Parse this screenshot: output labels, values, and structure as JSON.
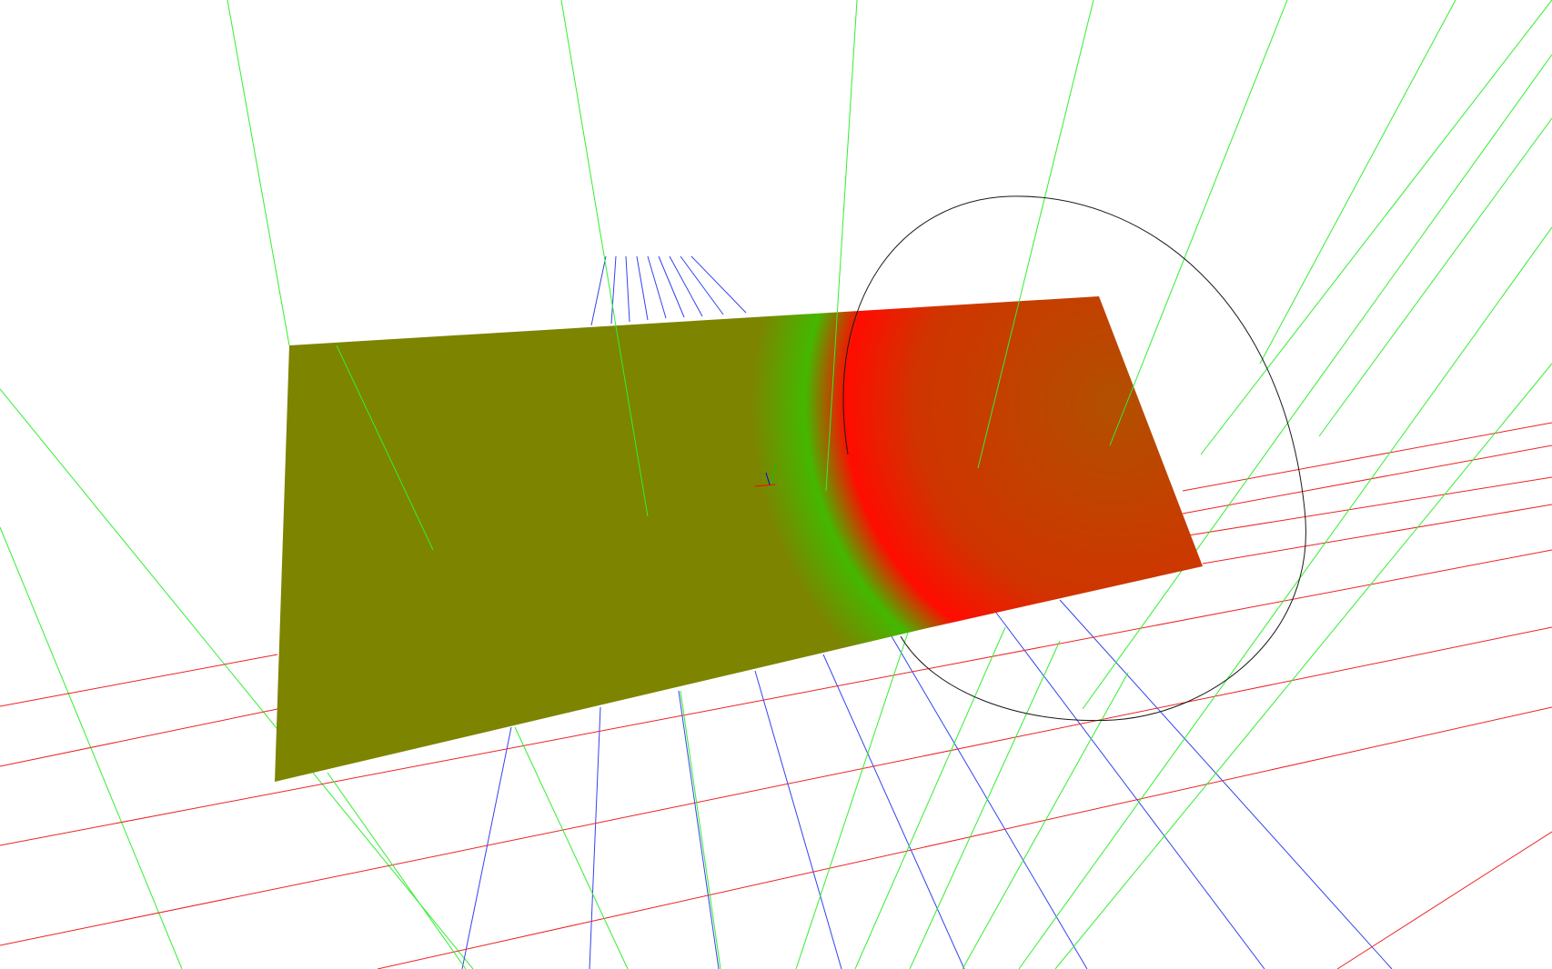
{
  "scene": {
    "background": "#ffffff",
    "colors": {
      "green_lines": "#33ee33",
      "blue_lines": "#3344ee",
      "red_lines": "#ee2222",
      "circle": "#1a1a1a",
      "surface_olive": "#7d8400",
      "surface_green": "#44b800",
      "surface_red": "#ff0c00",
      "surface_orange": "#b25000",
      "axis_red": "#ff0000",
      "axis_blue": "#0000ff",
      "axis_green": "#00cc00"
    }
  }
}
